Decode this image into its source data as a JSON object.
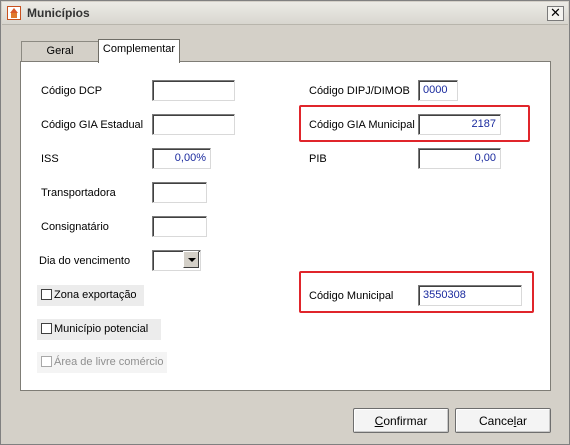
{
  "window": {
    "title": "Municípios"
  },
  "tabs": [
    {
      "label": "Geral",
      "active": false
    },
    {
      "label": "Complementar",
      "active": true
    }
  ],
  "form": {
    "codigo_dcp": {
      "label": "Código DCP",
      "value": ""
    },
    "codigo_gia_estadual": {
      "label": "Código GIA Estadual",
      "value": ""
    },
    "iss": {
      "label": "ISS",
      "value": "0,00%"
    },
    "transportadora": {
      "label": "Transportadora",
      "value": ""
    },
    "consignatario": {
      "label": "Consignatário",
      "value": ""
    },
    "dia_vencimento": {
      "label": "Dia do vencimento",
      "value": ""
    },
    "codigo_dipj_dimob": {
      "label": "Código DIPJ/DIMOB",
      "value": "0000"
    },
    "codigo_gia_municipal": {
      "label": "Código GIA Municipal",
      "value": "2187"
    },
    "pib": {
      "label": "PIB",
      "value": "0,00"
    },
    "codigo_municipal": {
      "label": "Código Municipal",
      "value": "3550308"
    },
    "zona_exportacao": {
      "label": "Zona exportação",
      "checked": false
    },
    "municipio_potencial": {
      "label": "Município potencial",
      "checked": false
    },
    "area_livre_comercio": {
      "label": "Área de livre comércio",
      "checked": false,
      "enabled": false
    }
  },
  "buttons": {
    "confirmar": {
      "prefix": "",
      "mnemonic": "C",
      "rest": "onfirmar"
    },
    "cancelar": {
      "prefix": "Cance",
      "mnemonic": "l",
      "rest": "ar"
    }
  },
  "colors": {
    "highlight": "#e0252b",
    "field_text": "#1a2a9e"
  }
}
